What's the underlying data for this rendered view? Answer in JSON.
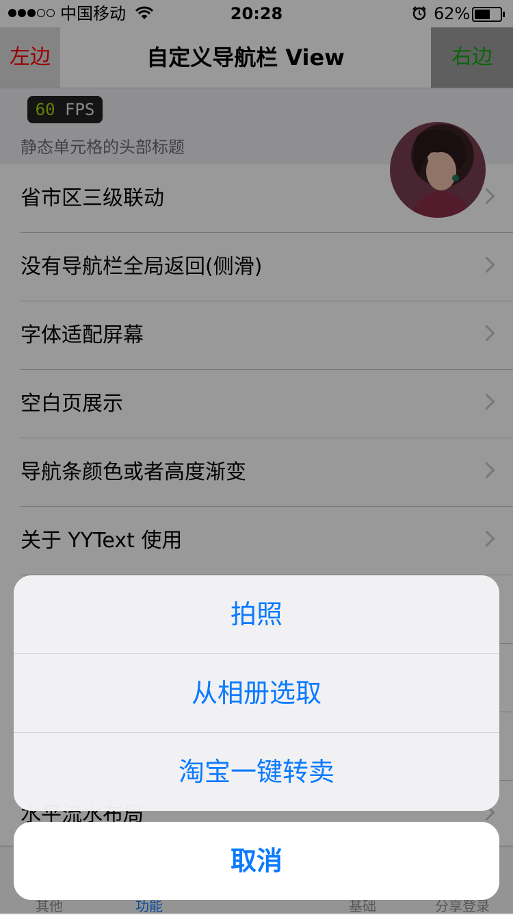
{
  "status_bar": {
    "carrier": "中国移动",
    "time": "20:28",
    "battery_percent": "62%",
    "battery_level": 0.62,
    "signal_strength_dots": 3,
    "signal_total_dots": 5
  },
  "nav_bar": {
    "left_label": "左边",
    "title": "自定义导航栏 View",
    "right_label": "右边"
  },
  "fps_badge": {
    "value": "60",
    "unit": "FPS"
  },
  "section_header": "静态单元格的头部标题",
  "list_items": [
    {
      "label": "省市区三级联动"
    },
    {
      "label": "没有导航栏全局返回(侧滑)"
    },
    {
      "label": "字体适配屏幕"
    },
    {
      "label": "空白页展示"
    },
    {
      "label": "导航条颜色或者高度渐变"
    },
    {
      "label": "关于 YYText 使用"
    },
    {
      "label": ""
    },
    {
      "label": ""
    },
    {
      "label": ""
    },
    {
      "label": "水平流水布局"
    }
  ],
  "tab_bar": {
    "items": [
      {
        "label": "其他",
        "selected": false
      },
      {
        "label": "功能",
        "selected": true
      },
      {
        "label": "",
        "selected": false
      },
      {
        "label": "基础",
        "selected": false
      },
      {
        "label": "分享登录",
        "selected": false
      }
    ]
  },
  "action_sheet": {
    "options": [
      {
        "label": "拍照"
      },
      {
        "label": "从相册选取"
      },
      {
        "label": "淘宝一键转卖"
      }
    ],
    "cancel_label": "取消"
  },
  "colors": {
    "action_blue": "#0a7aff",
    "nav_left_text": "#ff0000",
    "nav_right_text": "#12a812",
    "fps_green": "#a6d60b"
  }
}
